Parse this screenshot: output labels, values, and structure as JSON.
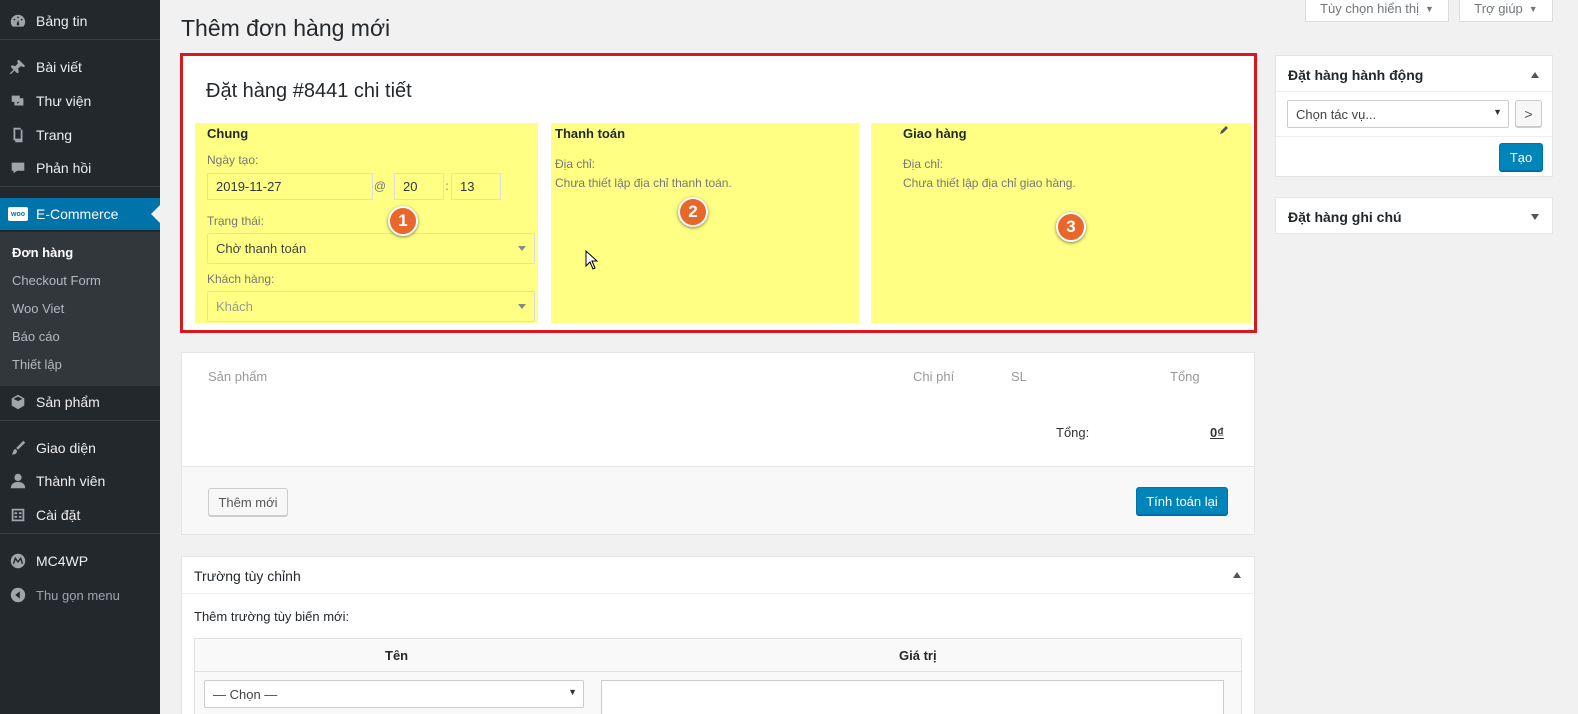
{
  "page_title": "Thêm đơn hàng mới",
  "top_buttons": {
    "screen_options": "Tùy chọn hiển thị",
    "help": "Trợ giúp"
  },
  "sidebar": {
    "items": [
      {
        "label": "Bảng tin",
        "icon": "dashboard-icon"
      },
      {
        "label": "Bài viết",
        "icon": "pin-icon"
      },
      {
        "label": "Thư viện",
        "icon": "media-icon"
      },
      {
        "label": "Trang",
        "icon": "page-icon"
      },
      {
        "label": "Phản hồi",
        "icon": "comment-icon"
      },
      {
        "label": "E-Commerce",
        "icon": "woo-icon"
      },
      {
        "label": "Sản phẩm",
        "icon": "box-icon"
      },
      {
        "label": "Giao diện",
        "icon": "brush-icon"
      },
      {
        "label": "Thành viên",
        "icon": "user-icon"
      },
      {
        "label": "Cài đặt",
        "icon": "settings-icon"
      },
      {
        "label": "MC4WP",
        "icon": "mc4wp-icon"
      },
      {
        "label": "Thu gọn menu",
        "icon": "collapse-icon"
      }
    ],
    "woo_badge": "woo",
    "submenu": [
      "Đơn hàng",
      "Checkout Form",
      "Woo Viet",
      "Báo cáo",
      "Thiết lập"
    ]
  },
  "order": {
    "heading": "Đặt hàng #8441 chi tiết",
    "general": {
      "title": "Chung",
      "date_label": "Ngày tạo:",
      "date": "2019-11-27",
      "at": "@",
      "hour": "20",
      "colon": ":",
      "minute": "13",
      "status_label": "Trạng thái:",
      "status": "Chờ thanh toán",
      "customer_label": "Khách hàng:",
      "customer": "Khách"
    },
    "billing": {
      "title": "Thanh toán",
      "address_label": "Địa chỉ:",
      "address": "Chưa thiết lập địa chỉ thanh toán."
    },
    "shipping": {
      "title": "Giao hàng",
      "address_label": "Địa chỉ:",
      "address": "Chưa thiết lập địa chỉ giao hàng."
    },
    "badges": [
      "1",
      "2",
      "3"
    ]
  },
  "items": {
    "headers": {
      "product": "Sản phẩm",
      "cost": "Chi phí",
      "qty": "SL",
      "total": "Tổng"
    },
    "total_label": "Tổng:",
    "total_value": "0₫",
    "add_button": "Thêm mới",
    "recalc_button": "Tính toán lại"
  },
  "custom_fields": {
    "title": "Trường tùy chỉnh",
    "add_label": "Thêm trường tùy biến mới:",
    "col_name": "Tên",
    "col_value": "Giá trị",
    "select_placeholder": "— Chọn —"
  },
  "actions_box": {
    "title": "Đặt hàng hành động",
    "select": "Chọn tác vụ...",
    "go": ">",
    "create_button": "Tạo"
  },
  "notes_box": {
    "title": "Đặt hàng ghi chú"
  },
  "colors": {
    "sidebar": "#23282d",
    "accent": "#0073aa",
    "highlight": "#ffff84",
    "frame": "#d9181e",
    "badge": "#e8672b"
  }
}
